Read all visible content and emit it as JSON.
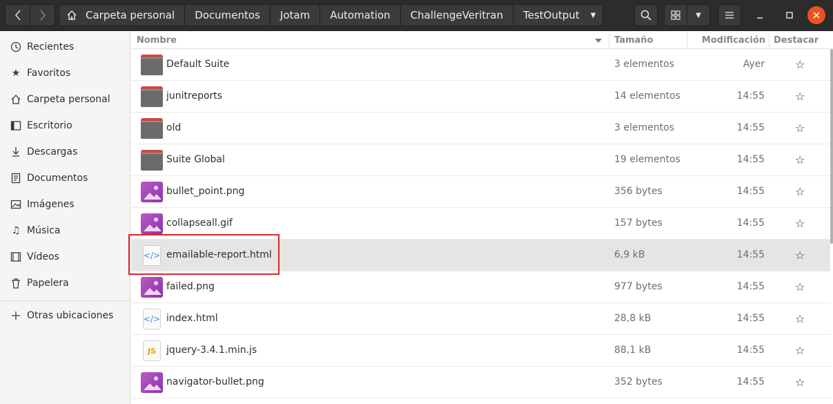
{
  "breadcrumbs": [
    "Carpeta personal",
    "Documentos",
    "Jotam",
    "Automation",
    "ChallengeVeritran",
    "TestOutput"
  ],
  "sidebar": {
    "items": [
      {
        "label": "Recientes",
        "icon": "clock-icon"
      },
      {
        "label": "Favoritos",
        "icon": "star-icon"
      },
      {
        "label": "Carpeta personal",
        "icon": "home-icon"
      },
      {
        "label": "Escritorio",
        "icon": "desktop-icon"
      },
      {
        "label": "Descargas",
        "icon": "download-icon"
      },
      {
        "label": "Documentos",
        "icon": "document-icon"
      },
      {
        "label": "Imágenes",
        "icon": "image-icon"
      },
      {
        "label": "Música",
        "icon": "music-icon"
      },
      {
        "label": "Vídeos",
        "icon": "video-icon"
      },
      {
        "label": "Papelera",
        "icon": "trash-icon"
      },
      {
        "label": "Otras ubicaciones",
        "icon": "plus-icon"
      }
    ]
  },
  "columns": {
    "name": "Nombre",
    "size": "Tamaño",
    "modified": "Modificación",
    "starred": "Destacar"
  },
  "files": [
    {
      "name": "Default Suite",
      "size": "3 elementos",
      "modified": "Ayer",
      "type": "folder"
    },
    {
      "name": "junitreports",
      "size": "14 elementos",
      "modified": "14:55",
      "type": "folder"
    },
    {
      "name": "old",
      "size": "3 elementos",
      "modified": "14:55",
      "type": "folder"
    },
    {
      "name": "Suite Global",
      "size": "19 elementos",
      "modified": "14:55",
      "type": "folder"
    },
    {
      "name": "bullet_point.png",
      "size": "356 bytes",
      "modified": "14:55",
      "type": "image"
    },
    {
      "name": "collapseall.gif",
      "size": "157 bytes",
      "modified": "14:55",
      "type": "image"
    },
    {
      "name": "emailable-report.html",
      "size": "6,9 kB",
      "modified": "14:55",
      "type": "html",
      "selected": true
    },
    {
      "name": "failed.png",
      "size": "977 bytes",
      "modified": "14:55",
      "type": "image"
    },
    {
      "name": "index.html",
      "size": "28,8 kB",
      "modified": "14:55",
      "type": "html"
    },
    {
      "name": "jquery-3.4.1.min.js",
      "size": "88,1 kB",
      "modified": "14:55",
      "type": "js"
    },
    {
      "name": "navigator-bullet.png",
      "size": "352 bytes",
      "modified": "14:55",
      "type": "image"
    }
  ],
  "icons": {
    "html_glyph": "</>",
    "js_glyph": "JS",
    "star_glyph": "☆"
  },
  "colors": {
    "accent": "#e95420",
    "highlight": "#d62828",
    "selected_row": "#e6e5e4"
  }
}
